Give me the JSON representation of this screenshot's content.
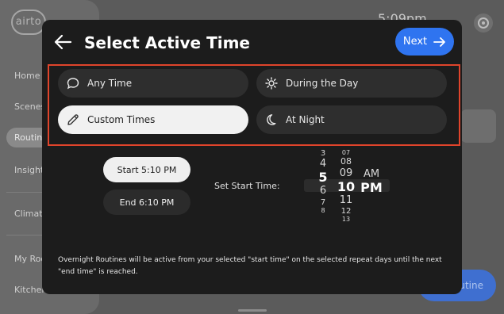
{
  "background": {
    "logo": "airto",
    "time": "5:09pm",
    "nav": [
      "Home",
      "Scenes",
      "Routine",
      "Insight",
      "Climate",
      "My Roo",
      "Kitchen"
    ],
    "pill_text": "utine"
  },
  "modal": {
    "title": "Select Active Time",
    "next_label": "Next",
    "options": [
      {
        "label": "Any Time",
        "icon": "chat-bubble-icon",
        "selected": false
      },
      {
        "label": "During the Day",
        "icon": "sun-icon",
        "selected": false
      },
      {
        "label": "Custom Times",
        "icon": "pencil-icon",
        "selected": true
      },
      {
        "label": "At Night",
        "icon": "moon-icon",
        "selected": false
      }
    ],
    "start_label": "Start 5:10 PM",
    "end_label": "End 6:10 PM",
    "set_label": "Set Start Time:",
    "picker": {
      "hours": [
        "3",
        "4",
        "5",
        "6",
        "7",
        "8"
      ],
      "minutes": [
        "07",
        "08",
        "09",
        "10",
        "11",
        "12",
        "13"
      ],
      "periods": [
        "AM",
        "PM"
      ],
      "selected_hour": "5",
      "selected_minute": "10",
      "selected_period": "PM"
    },
    "note": "Overnight Routines will be active from your selected \"start time\" on the selected repeat days until the next \"end time\" is reached."
  },
  "colors": {
    "accent": "#2f74f0",
    "highlight_border": "#e0442b",
    "modal_bg": "#1c1c1c"
  }
}
